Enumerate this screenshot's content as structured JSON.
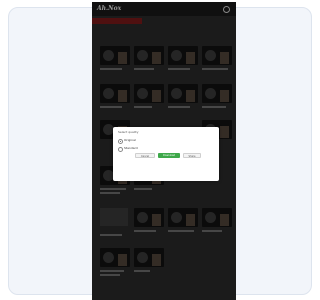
{
  "modal": {
    "title": "Select quality",
    "options": [
      {
        "label": "Original",
        "note": "",
        "checked": true
      },
      {
        "label": "Standard",
        "note": "",
        "checked": false
      }
    ],
    "buttons": [
      "Cancel",
      "Download",
      "Share"
    ],
    "hint": "",
    "link": ""
  },
  "colors": {
    "page_bg": "#ffffff",
    "card_bg": "#f2f5fa",
    "phone_bg": "#2a2a2a",
    "accent_red": "#7a1a1a",
    "primary_green": "#3ea84a"
  },
  "icons": {
    "top_right": "search-icon"
  }
}
